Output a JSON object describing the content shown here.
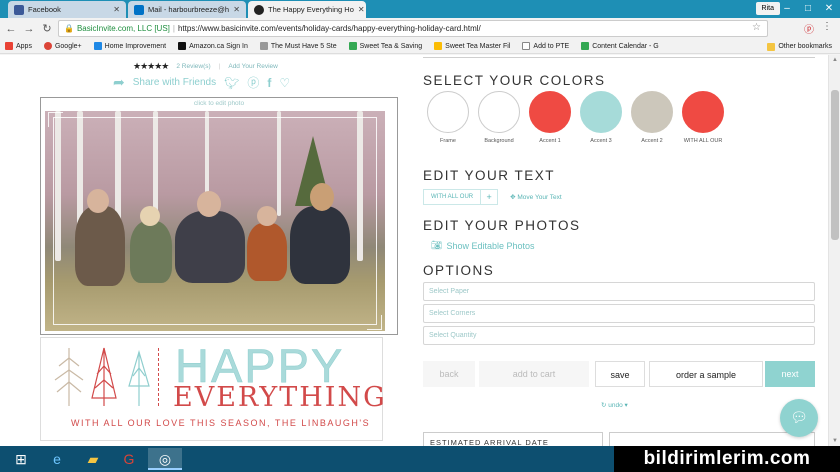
{
  "browser": {
    "tabs": [
      {
        "label": "Facebook",
        "color": "#3b5998"
      },
      {
        "label": "Mail - harbourbreeze@h",
        "color": "#0072c6"
      },
      {
        "label": "The Happy Everything Ho",
        "color": "#222222"
      }
    ],
    "profile": "Rita",
    "secure_label": "BasicInvite.com, LLC [US]",
    "url": "https://www.basicinvite.com/events/holiday-cards/happy-everything-holiday-card.html/"
  },
  "bookmarks": {
    "items": [
      "Apps",
      "Google+",
      "Home Improvement",
      "Amazon.ca Sign In",
      "The Must Have 5 Ste",
      "Sweet Tea & Saving",
      "Sweet Tea Master Fil",
      "Add to PTE",
      "Content Calendar - G"
    ],
    "other": "Other bookmarks"
  },
  "product": {
    "stars": "★★★★★",
    "reviews": "2 Review(s)",
    "add_review": "Add Your Review",
    "share": "Share with Friends",
    "edit_hint": "click to edit photo",
    "happy": "HAPPY",
    "everything": "EVERYTHING",
    "tagline": "WITH ALL OUR LOVE THIS SEASON, THE LINBAUGH'S"
  },
  "colors": {
    "title": "SELECT YOUR COLORS",
    "swatches": [
      {
        "label": "Frame",
        "color": "#ffffff"
      },
      {
        "label": "Background",
        "color": "#ffffff"
      },
      {
        "label": "Accent 1",
        "color": "#ef4a43"
      },
      {
        "label": "Accent 3",
        "color": "#a6dbd9"
      },
      {
        "label": "Accent 2",
        "color": "#ccc7bb"
      },
      {
        "label": "WITH ALL OUR",
        "color": "#ef4a43"
      }
    ]
  },
  "edit_text": {
    "title": "EDIT YOUR TEXT",
    "chip": "WITH ALL OUR",
    "plus": "+",
    "move": "Move Your Text"
  },
  "edit_photos": {
    "title": "EDIT YOUR PHOTOS",
    "link": "Show Editable Photos"
  },
  "options": {
    "title": "OPTIONS",
    "paper": "Select Paper",
    "corners": "Select Corners",
    "quantity": "Select Quantity"
  },
  "actions": {
    "back": "back",
    "cart": "add to cart",
    "save": "save",
    "sample": "order a sample",
    "next": "next",
    "undo": "undo"
  },
  "arrival": {
    "label": "ESTIMATED ARRIVAL DATE"
  },
  "watermark": "bildirimlerim.com"
}
